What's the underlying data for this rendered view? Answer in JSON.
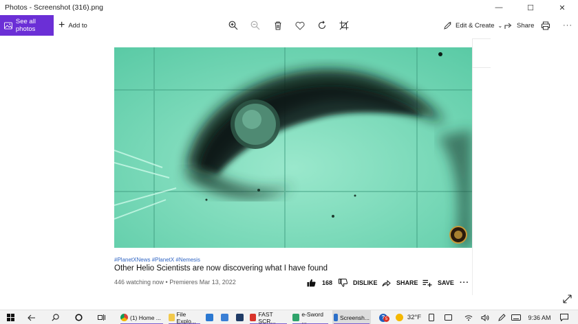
{
  "window": {
    "title": "Photos - Screenshot (316).png"
  },
  "toolbar": {
    "see_all": "See all photos",
    "add_to": "Add to",
    "edit_create": "Edit & Create",
    "share": "Share"
  },
  "video": {
    "hashtags": "#PlanetXNews #PlanetX #Nemesis",
    "title": "Other Helio Scientists are now discovering what I have found",
    "meta": "446 watching now • Premieres Mar 13, 2022",
    "likes": "168",
    "dislike": "DISLIKE",
    "share": "SHARE",
    "save": "SAVE",
    "colors": {
      "frame": "#6fd7b6",
      "dark": "#0d1f18"
    }
  },
  "taskbar": {
    "apps": [
      {
        "label": "(1) Home ...",
        "icon": "chrome-icon"
      },
      {
        "label": "File Explo...",
        "icon": "folder-icon"
      },
      {
        "label": "",
        "icon": "mail-icon"
      },
      {
        "label": "",
        "icon": "store-icon"
      },
      {
        "label": "",
        "icon": "app-icon"
      },
      {
        "label": "FAST SCR...",
        "icon": "pdf-icon"
      },
      {
        "label": "e-Sword ...",
        "icon": "sword-icon"
      },
      {
        "label": "Screensh...",
        "icon": "photos-icon"
      }
    ],
    "badge": "5",
    "temperature": "32°F",
    "time": "9:36 AM"
  }
}
